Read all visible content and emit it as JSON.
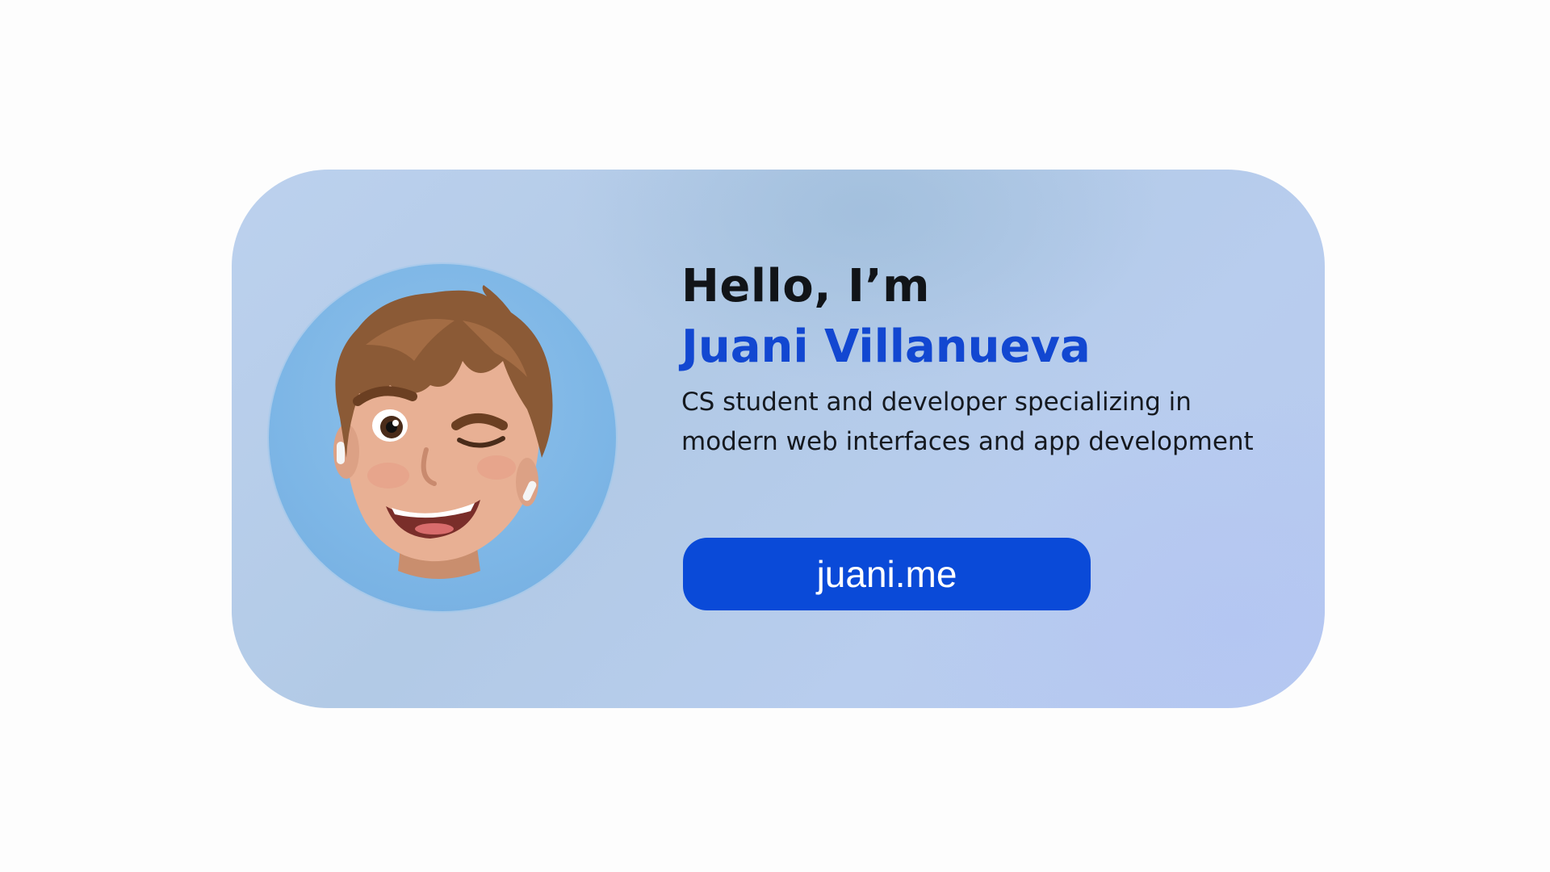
{
  "card": {
    "greeting": "Hello, I’m",
    "name": "Juani Villanueva",
    "bio": "CS student and developer specializing in modern web interfaces and app development",
    "link_label": "juani.me"
  },
  "avatar": {
    "icon": "memoji-avatar-winking"
  },
  "colors": {
    "page_background": "#fdfdfd",
    "card_background": "#b8cdee",
    "avatar_circle": "#7db6e6",
    "name_accent": "#1247d1",
    "button_background": "#0a4ad8",
    "button_text": "#ffffff",
    "greeting_text": "#111418"
  }
}
